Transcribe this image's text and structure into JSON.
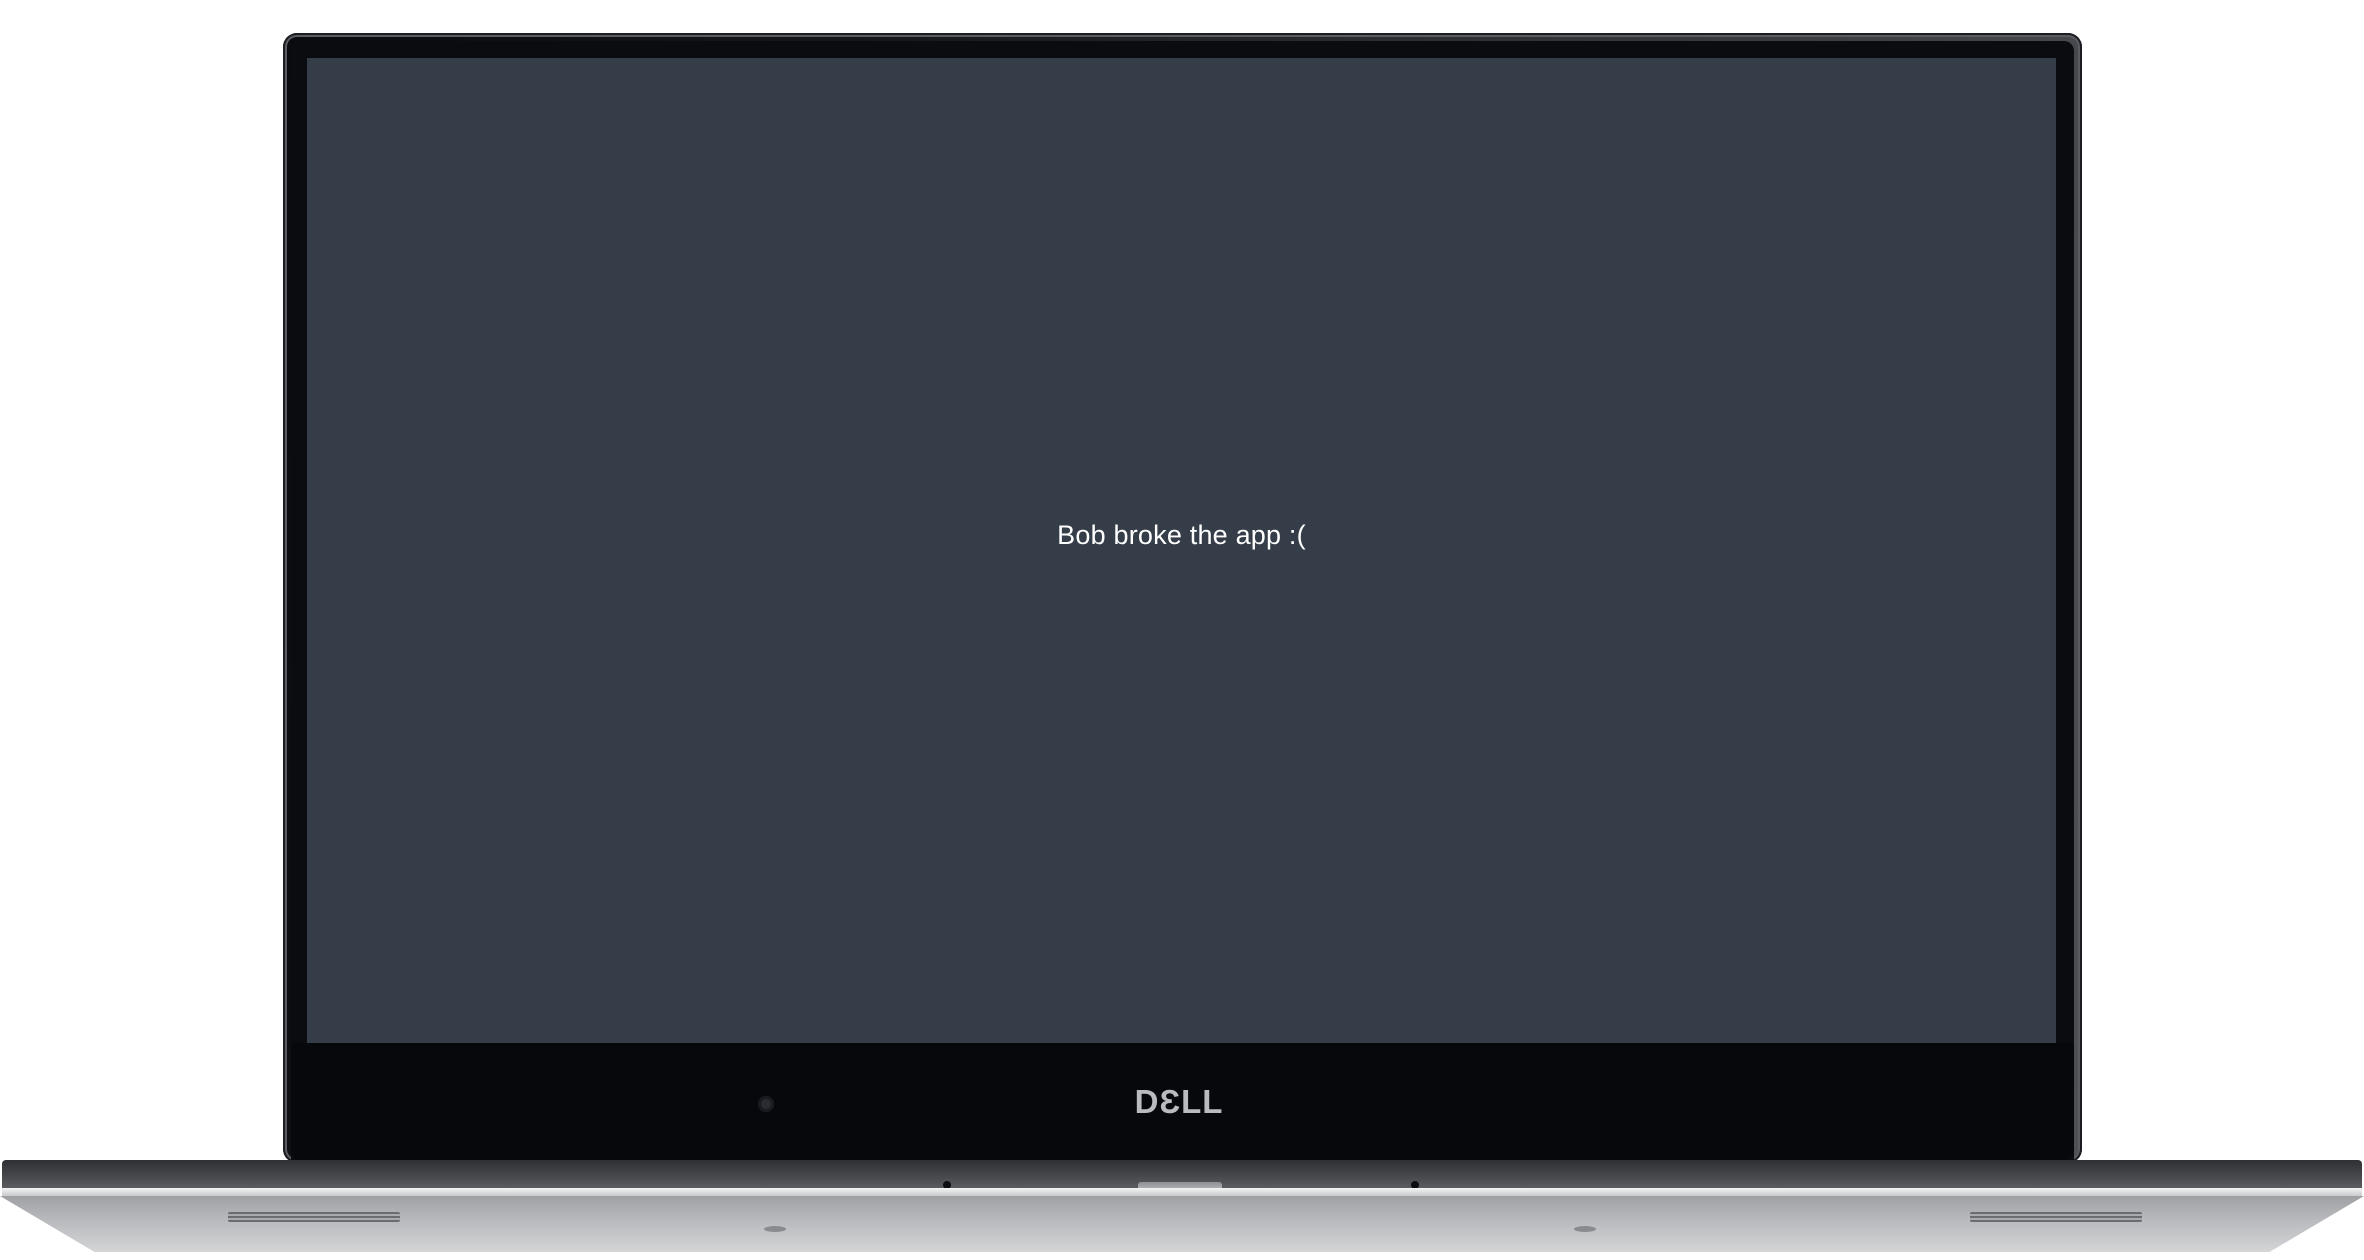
{
  "screen": {
    "message": "Bob broke the app :(",
    "background": "#343d48",
    "text_color": "#ffffff"
  },
  "device": {
    "brand_logo": "DƐLL",
    "camera_icon": "webcam-icon"
  }
}
